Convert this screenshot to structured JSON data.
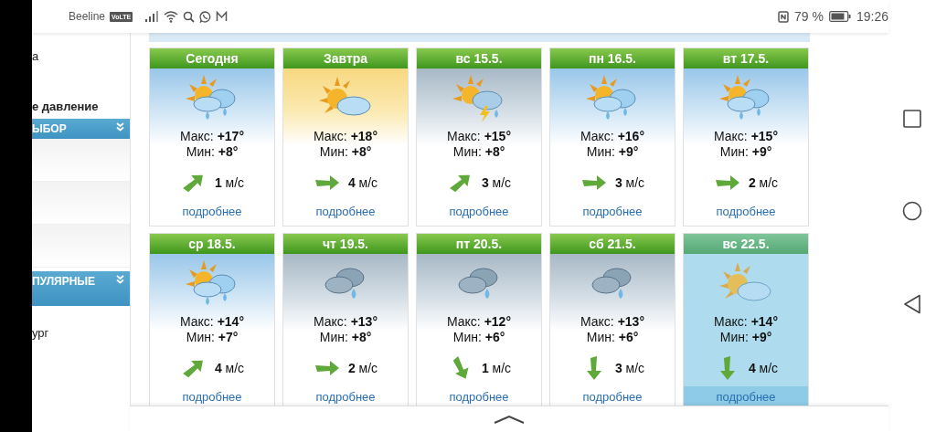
{
  "status_bar": {
    "carrier": "Beeline",
    "volte": "VoLTE",
    "battery_text": "79 %",
    "time": "19:26"
  },
  "sidebar": {
    "items": [
      {
        "kind": "text",
        "label": "а",
        "bold": false
      },
      {
        "kind": "text",
        "label": "е давление",
        "bold": true
      },
      {
        "kind": "header",
        "label": "ЫБОР"
      },
      {
        "kind": "blank"
      },
      {
        "kind": "blank"
      },
      {
        "kind": "blank"
      },
      {
        "kind": "header",
        "label": "ПУЛЯРНЫЕ"
      },
      {
        "kind": "text",
        "label": "ург",
        "bold": false
      }
    ]
  },
  "days": [
    {
      "title": "Сегодня",
      "sky": {
        "kind": "blue"
      },
      "icon": {
        "kind": "partly-rain"
      },
      "max": "Макс: **+17°**",
      "min": "Мин: **+8°**",
      "wind": {
        "kind": "ne"
      },
      "speed": "**1** м/с",
      "link": "подробнее",
      "selected": false
    },
    {
      "title": "Завтра",
      "sky": {
        "kind": "sunny"
      },
      "icon": {
        "kind": "partly-cloudy"
      },
      "max": "Макс: **+18°**",
      "min": "Мин: **+8°**",
      "wind": {
        "kind": "e"
      },
      "speed": "**4** м/с",
      "link": "подробнее",
      "selected": false
    },
    {
      "title": "вс 15.5.",
      "sky": {
        "kind": "grey"
      },
      "icon": {
        "kind": "thunder"
      },
      "max": "Макс: **+15°**",
      "min": "Мин: **+8°**",
      "wind": {
        "kind": "ne"
      },
      "speed": "**3** м/с",
      "link": "подробнее",
      "selected": false
    },
    {
      "title": "пн 16.5.",
      "sky": {
        "kind": "blue"
      },
      "icon": {
        "kind": "partly-rain"
      },
      "max": "Макс: **+16°**",
      "min": "Мин: **+9°**",
      "wind": {
        "kind": "e"
      },
      "speed": "**3** м/с",
      "link": "подробнее",
      "selected": false
    },
    {
      "title": "вт 17.5.",
      "sky": {
        "kind": "blue"
      },
      "icon": {
        "kind": "partly-rain"
      },
      "max": "Макс: **+15°**",
      "min": "Мин: **+9°**",
      "wind": {
        "kind": "e"
      },
      "speed": "**2** м/с",
      "link": "подробнее",
      "selected": false
    },
    {
      "title": "ср 18.5.",
      "sky": {
        "kind": "blue"
      },
      "icon": {
        "kind": "partly-rain"
      },
      "max": "Макс: **+14°**",
      "min": "Мин: **+7°**",
      "wind": {
        "kind": "ne"
      },
      "speed": "**4** м/с",
      "link": "подробнее",
      "selected": false
    },
    {
      "title": "чт 19.5.",
      "sky": {
        "kind": "grey"
      },
      "icon": {
        "kind": "rain"
      },
      "max": "Макс: **+13°**",
      "min": "Мин: **+8°**",
      "wind": {
        "kind": "e"
      },
      "speed": "**2** м/с",
      "link": "подробнее",
      "selected": false
    },
    {
      "title": "пт 20.5.",
      "sky": {
        "kind": "grey"
      },
      "icon": {
        "kind": "rain"
      },
      "max": "Макс: **+12°**",
      "min": "Мин: **+6°**",
      "wind": {
        "kind": "sse"
      },
      "speed": "**1** м/с",
      "link": "подробнее",
      "selected": false
    },
    {
      "title": "сб 21.5.",
      "sky": {
        "kind": "grey"
      },
      "icon": {
        "kind": "rain"
      },
      "max": "Макс: **+13°**",
      "min": "Мин: **+6°**",
      "wind": {
        "kind": "s"
      },
      "speed": "**3** м/с",
      "link": "подробнее",
      "selected": false
    },
    {
      "title": "вс 22.5.",
      "sky": {
        "kind": "blue"
      },
      "icon": {
        "kind": "partly-cloudy"
      },
      "max": "Макс: **+14°**",
      "min": "Мин: **+9°**",
      "wind": {
        "kind": "s"
      },
      "speed": "**4** м/с",
      "link": "подробнее",
      "selected": true
    }
  ]
}
